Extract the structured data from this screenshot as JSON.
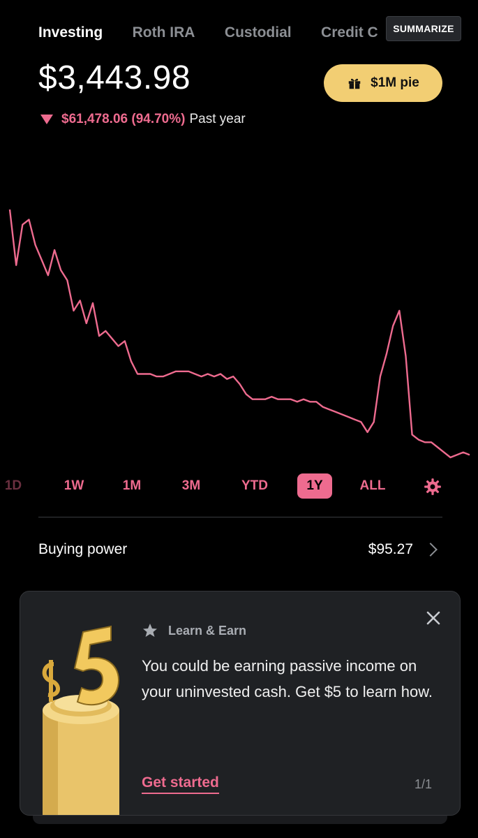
{
  "tabs": [
    {
      "label": "Investing",
      "active": true
    },
    {
      "label": "Roth IRA",
      "active": false
    },
    {
      "label": "Custodial",
      "active": false
    },
    {
      "label": "Credit C",
      "active": false
    }
  ],
  "summarize_label": "SUMMARIZE",
  "portfolio": {
    "balance": "$3,443.98",
    "change_value": "$61,478.06 (94.70%)",
    "change_period": "Past year",
    "change_direction": "down"
  },
  "promo_button": {
    "label": "$1M pie",
    "icon": "gift-icon"
  },
  "ranges": [
    {
      "label": "1D",
      "active": false
    },
    {
      "label": "1W",
      "active": false
    },
    {
      "label": "1M",
      "active": false
    },
    {
      "label": "3M",
      "active": false
    },
    {
      "label": "YTD",
      "active": false
    },
    {
      "label": "1Y",
      "active": true
    },
    {
      "label": "ALL",
      "active": false
    }
  ],
  "buying_power": {
    "label": "Buying power",
    "value": "$95.27"
  },
  "card": {
    "tag": "Learn & Earn",
    "body": "You could be earning passive income on your uninvested cash. Get $5 to learn how.",
    "cta": "Get started",
    "pager": "1/1"
  },
  "colors": {
    "accent": "#ee6b8f",
    "promo": "#f2ce73",
    "background": "#000000",
    "card": "#1f2124"
  },
  "chart_data": {
    "type": "line",
    "period": "1Y",
    "series": [
      {
        "values": [
          100,
          78,
          94,
          96,
          86,
          80,
          74,
          84,
          76,
          72,
          60,
          64,
          55,
          63,
          50,
          52,
          49,
          46,
          48,
          40,
          35,
          35,
          35,
          34,
          34,
          35,
          36,
          36,
          36,
          35,
          34,
          35,
          34,
          35,
          33,
          34,
          31,
          27,
          25,
          25,
          25,
          26,
          25,
          25,
          25,
          24,
          25,
          24,
          24,
          22,
          21,
          20,
          19,
          18,
          17,
          16,
          12,
          16,
          34,
          43,
          54,
          60,
          42,
          11,
          9,
          8,
          8,
          6,
          4,
          2,
          3,
          4,
          3
        ]
      }
    ]
  }
}
